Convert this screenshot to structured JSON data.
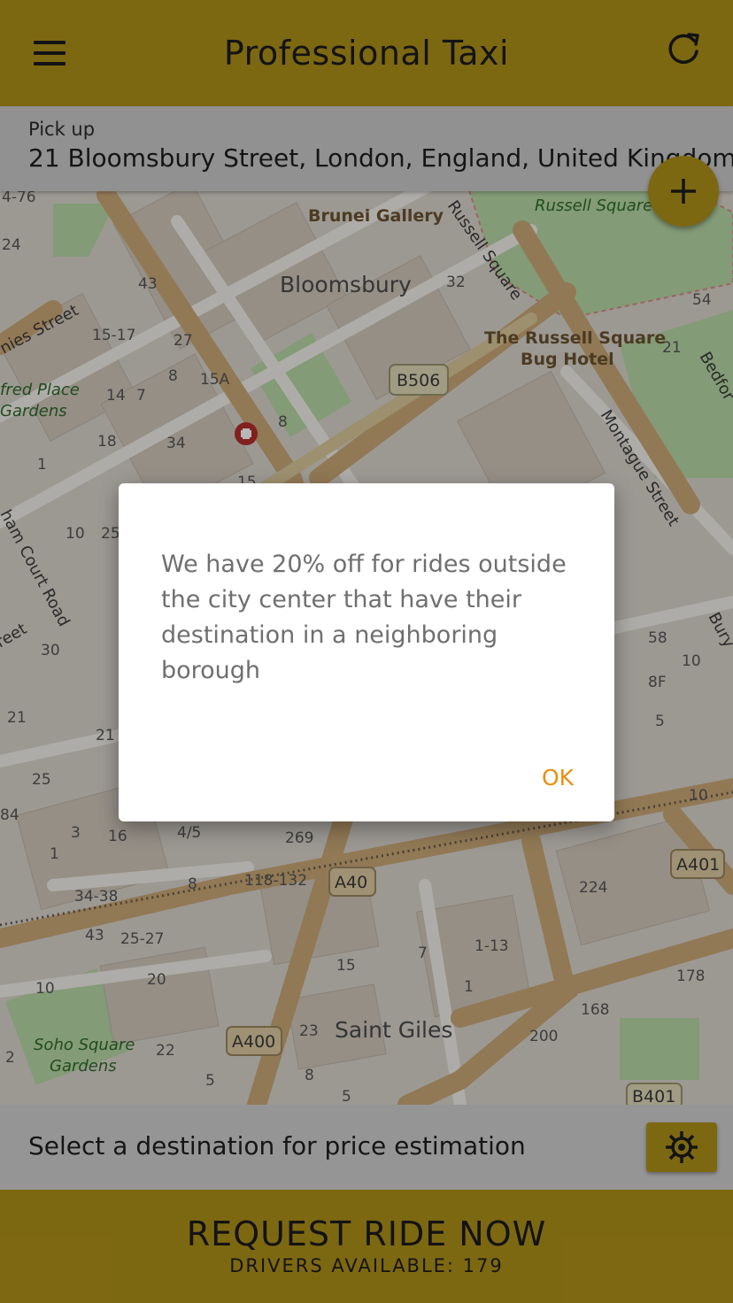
{
  "header": {
    "title": "Professional Taxi",
    "menu_icon": "hamburger-menu-icon",
    "refresh_icon": "refresh-icon"
  },
  "pickup": {
    "label": "Pick up",
    "address": "21 Bloomsbury Street, London, England, United Kingdom"
  },
  "fab": {
    "icon": "plus-icon"
  },
  "map": {
    "labels": {
      "brunei_gallery": "Brunei Gallery",
      "russell_square_park": "Russell Square",
      "russell_square_street": "Russell Square",
      "bloomsbury": "Bloomsbury",
      "russell_hotel_1": "The Russell Square",
      "russell_hotel_2": "Bug Hotel",
      "montague_street": "Montague Street",
      "b506": "B506",
      "a40": "A40",
      "a401": "A401",
      "a400": "A400",
      "b401": "B401",
      "saint_giles": "Saint Giles",
      "soho_square_1": "Soho Square",
      "soho_square_2": "Gardens",
      "alfred_place_1": "fred Place",
      "alfred_place_2": "Gardens",
      "chenies_street": "nies Street",
      "tottenham_court_road": "ham Court Road",
      "street_left": "reet",
      "bedford": "Bedfor",
      "bury": "Bury"
    },
    "numbers": [
      "4-76",
      "24",
      "43",
      "32",
      "54",
      "15-17",
      "27",
      "21",
      "8",
      "15A",
      "14",
      "7",
      "18",
      "34",
      "1",
      "15",
      "10",
      "25",
      "30",
      "21",
      "8",
      "58",
      "10",
      "8F",
      "5",
      "21",
      "25",
      "84",
      "3",
      "16",
      "4/5",
      "269",
      "10",
      "1",
      "34-38",
      "118-132",
      "8",
      "224",
      "43",
      "25-27",
      "7",
      "1-13",
      "15",
      "10",
      "20",
      "1",
      "178",
      "168",
      "23",
      "200",
      "22",
      "2",
      "5",
      "8",
      "5"
    ]
  },
  "dialog": {
    "message": "We have 20% off for rides outside the city center that have their destination in a neighboring borough",
    "ok_label": "OK"
  },
  "destination": {
    "text": "Select a destination for price estimation",
    "settings_icon": "gear-icon"
  },
  "request": {
    "label": "REQUEST RIDE NOW",
    "drivers": "DRIVERS AVAILABLE: 179"
  },
  "colors": {
    "accent": "#ae9119",
    "ok_text": "#ec8c0e",
    "map_road_major": "#d7b880",
    "map_park": "#b9d8a8",
    "map_building": "#cfc6ba"
  }
}
